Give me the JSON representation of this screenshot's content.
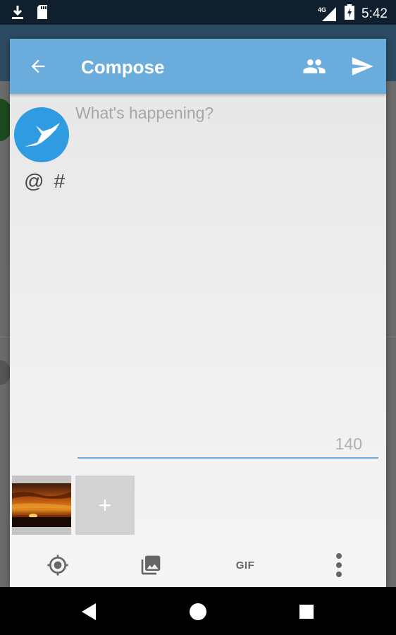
{
  "status_bar": {
    "time": "5:42",
    "network": "4G",
    "icons": [
      "download-icon",
      "sd-card-icon",
      "signal-icon",
      "battery-charging-icon"
    ]
  },
  "dialog": {
    "title": "Compose",
    "toolbar_icons": [
      "back-arrow-icon",
      "people-icon",
      "send-icon"
    ],
    "compose": {
      "placeholder": "What's happening?",
      "value": "",
      "char_count": "140"
    },
    "mention_symbol": "@",
    "hashtag_symbol": "#",
    "media": {
      "add_label": "+",
      "thumbnail": "sunset-photo"
    },
    "actions": {
      "location_icon": "location-target-icon",
      "gallery_icon": "gallery-icon",
      "gif_label": "GIF",
      "more_icon": "more-vert-icon"
    }
  },
  "nav_bar": {
    "icons": [
      "back-triangle-icon",
      "home-circle-icon",
      "recents-square-icon"
    ]
  },
  "colors": {
    "toolbar": "#6aaddc",
    "status_bar": "#0f1f2e",
    "accent": "#6aaddc",
    "avatar": "#2f9be0"
  }
}
